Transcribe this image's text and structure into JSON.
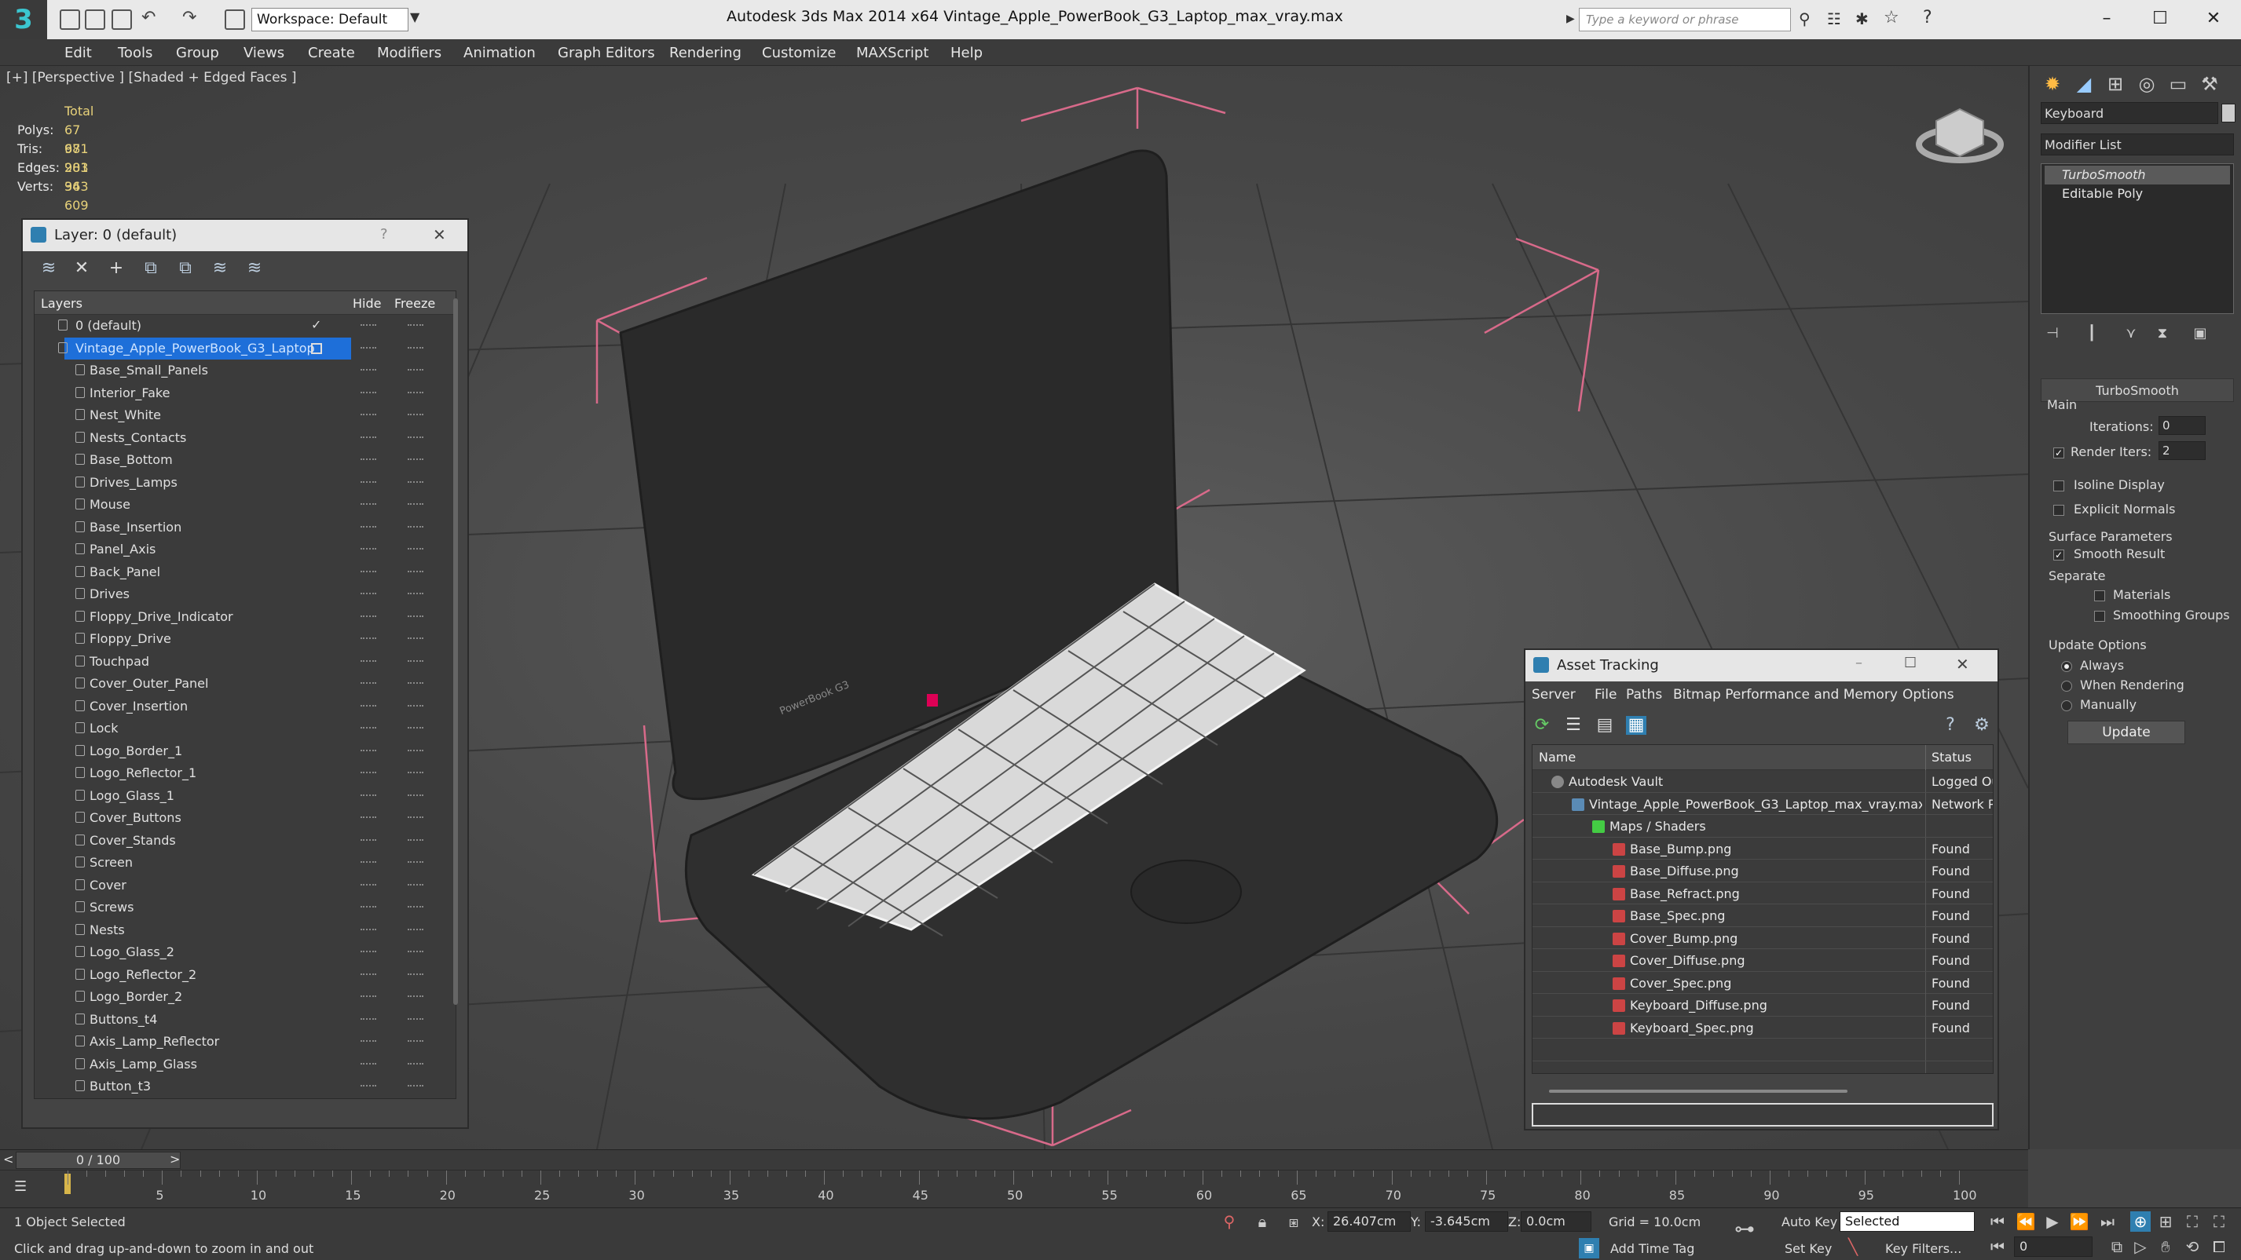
{
  "titlebar": {
    "app_logo": "3",
    "workspace_label": "Workspace: Default",
    "title": "Autodesk 3ds Max  2014 x64      Vintage_Apple_PowerBook_G3_Laptop_max_vray.max",
    "search_placeholder": "Type a keyword or phrase"
  },
  "menu": [
    "Edit",
    "Tools",
    "Group",
    "Views",
    "Create",
    "Modifiers",
    "Animation",
    "Graph Editors",
    "Rendering",
    "Customize",
    "MAXScript",
    "Help"
  ],
  "viewport": {
    "label": "[+] [Perspective ] [Shaded + Edged Faces ]",
    "stats": {
      "total_label": "Total",
      "rows": [
        {
          "k": "Polys:",
          "v": "67 981"
        },
        {
          "k": "Tris:",
          "v": "67 981"
        },
        {
          "k": "Edges:",
          "v": "203 943"
        },
        {
          "k": "Verts:",
          "v": "36 609"
        }
      ]
    },
    "label_3d": "PowerBook G3"
  },
  "layer_window": {
    "title": "Layer: 0 (default)",
    "help": "?",
    "close": "✕",
    "columns": {
      "layers": "Layers",
      "hide": "Hide",
      "freeze": "Freeze"
    },
    "layers": [
      {
        "name": "0 (default)",
        "level": 0
      },
      {
        "name": "Vintage_Apple_PowerBook_G3_Laptop",
        "level": 0,
        "selected": true
      },
      {
        "name": "Base_Small_Panels"
      },
      {
        "name": "Interior_Fake"
      },
      {
        "name": "Nest_White"
      },
      {
        "name": "Nests_Contacts"
      },
      {
        "name": "Base_Bottom"
      },
      {
        "name": "Drives_Lamps"
      },
      {
        "name": "Mouse"
      },
      {
        "name": "Base_Insertion"
      },
      {
        "name": "Panel_Axis"
      },
      {
        "name": "Back_Panel"
      },
      {
        "name": "Drives"
      },
      {
        "name": "Floppy_Drive_Indicator"
      },
      {
        "name": "Floppy_Drive"
      },
      {
        "name": "Touchpad"
      },
      {
        "name": "Cover_Outer_Panel"
      },
      {
        "name": "Cover_Insertion"
      },
      {
        "name": "Lock"
      },
      {
        "name": "Logo_Border_1"
      },
      {
        "name": "Logo_Reflector_1"
      },
      {
        "name": "Logo_Glass_1"
      },
      {
        "name": "Cover_Buttons"
      },
      {
        "name": "Cover_Stands"
      },
      {
        "name": "Screen"
      },
      {
        "name": "Cover"
      },
      {
        "name": "Screws"
      },
      {
        "name": "Nests"
      },
      {
        "name": "Logo_Glass_2"
      },
      {
        "name": "Logo_Reflector_2"
      },
      {
        "name": "Logo_Border_2"
      },
      {
        "name": "Buttons_t4"
      },
      {
        "name": "Axis_Lamp_Reflector"
      },
      {
        "name": "Axis_Lamp_Glass"
      },
      {
        "name": "Button_t3"
      }
    ]
  },
  "asset_window": {
    "title": "Asset Tracking",
    "menu": [
      "Server",
      "File",
      "Paths",
      "Bitmap Performance and Memory",
      "Options"
    ],
    "columns": {
      "name": "Name",
      "status": "Status"
    },
    "rows": [
      {
        "name": "Autodesk Vault",
        "status": "Logged Out",
        "indent": 0,
        "kind": "vault"
      },
      {
        "name": "Vintage_Apple_PowerBook_G3_Laptop_max_vray.max",
        "status": "Network Path",
        "indent": 1,
        "kind": "file"
      },
      {
        "name": "Maps / Shaders",
        "status": "",
        "indent": 2,
        "kind": "folder"
      },
      {
        "name": "Base_Bump.png",
        "status": "Found",
        "indent": 3,
        "kind": "png"
      },
      {
        "name": "Base_Diffuse.png",
        "status": "Found",
        "indent": 3,
        "kind": "png"
      },
      {
        "name": "Base_Refract.png",
        "status": "Found",
        "indent": 3,
        "kind": "png"
      },
      {
        "name": "Base_Spec.png",
        "status": "Found",
        "indent": 3,
        "kind": "png"
      },
      {
        "name": "Cover_Bump.png",
        "status": "Found",
        "indent": 3,
        "kind": "png"
      },
      {
        "name": "Cover_Diffuse.png",
        "status": "Found",
        "indent": 3,
        "kind": "png"
      },
      {
        "name": "Cover_Spec.png",
        "status": "Found",
        "indent": 3,
        "kind": "png"
      },
      {
        "name": "Keyboard_Diffuse.png",
        "status": "Found",
        "indent": 3,
        "kind": "png"
      },
      {
        "name": "Keyboard_Spec.png",
        "status": "Found",
        "indent": 3,
        "kind": "png"
      }
    ]
  },
  "command_panel": {
    "name_field": "Keyboard",
    "modifier_list": "Modifier List",
    "stack": [
      "TurboSmooth",
      "Editable Poly"
    ],
    "turbosmooth": {
      "title": "TurboSmooth",
      "main": "Main",
      "iterations_label": "Iterations:",
      "iterations": "0",
      "render_iters_label": "Render Iters:",
      "render_iters": "2",
      "isoline": "Isoline Display",
      "explicit": "Explicit Normals",
      "surface": "Surface Parameters",
      "smooth_result": "Smooth Result",
      "separate": "Separate",
      "materials": "Materials",
      "smoothing_groups": "Smoothing Groups",
      "update_options": "Update Options",
      "always": "Always",
      "when_rendering": "When Rendering",
      "manually": "Manually",
      "update": "Update"
    }
  },
  "timeline": {
    "frame": "0 / 100",
    "prev": "<",
    "next": ">",
    "ticks": [
      "5",
      "10",
      "15",
      "20",
      "25",
      "30",
      "35",
      "40",
      "45",
      "50",
      "55",
      "60",
      "65",
      "70",
      "75",
      "80",
      "85",
      "90",
      "95",
      "100"
    ]
  },
  "status": {
    "selection": "1 Object Selected",
    "prompt": "Click and drag up-and-down to zoom in and out",
    "x_label": "X:",
    "x": "26.407cm",
    "y_label": "Y:",
    "y": "-3.645cm",
    "z_label": "Z:",
    "z": "0.0cm",
    "grid": "Grid = 10.0cm",
    "add_time_tag": "Add Time Tag",
    "auto_key": "Auto Key",
    "set_key": "Set Key",
    "selected": "Selected",
    "key_filters": "Key Filters...",
    "frame_field": "0"
  }
}
